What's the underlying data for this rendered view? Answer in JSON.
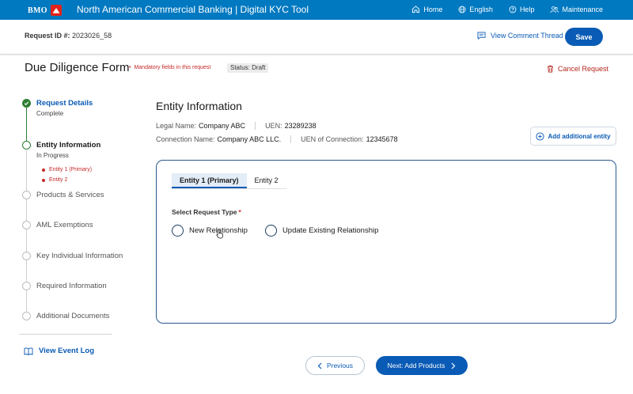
{
  "topbar": {
    "logo_text": "BMO",
    "title": "North American Commercial Banking | Digital KYC Tool",
    "nav": [
      {
        "label": "Home",
        "icon": "home-icon"
      },
      {
        "label": "English",
        "icon": "globe-icon"
      },
      {
        "label": "Help",
        "icon": "help-icon"
      },
      {
        "label": "Maintenance",
        "icon": "users-icon"
      }
    ]
  },
  "request": {
    "id_label": "Request ID #:",
    "id_value": "2023026_58",
    "comment_link": "View Comment Thread",
    "save_label": "Save"
  },
  "form": {
    "title": "Due Diligence Form",
    "mandatory_note": "Mandatory fields in this request",
    "status": "Status: Draft",
    "cancel_label": "Cancel Request"
  },
  "stepper": {
    "steps": [
      {
        "label": "Request Details",
        "sub": "Complete",
        "state": "done"
      },
      {
        "label": "Entity Information",
        "sub": "In Progress",
        "state": "active"
      },
      {
        "label": "Products & Services",
        "state": "pending"
      },
      {
        "label": "AML Exemptions",
        "state": "pending"
      },
      {
        "label": "Key Individual Information",
        "state": "pending"
      },
      {
        "label": "Required Information",
        "state": "pending"
      },
      {
        "label": "Additional Documents",
        "state": "pending"
      }
    ],
    "substeps": [
      "Entity 1 (Primary)",
      "Entity 2"
    ],
    "event_log": "View Event Log"
  },
  "entity": {
    "section_title": "Entity Information",
    "legal_name_label": "Legal Name:",
    "legal_name": "Company ABC",
    "uen_label": "UEN:",
    "uen": "23289238",
    "connection_name_label": "Connection Name:",
    "connection_name": "Company ABC LLC.",
    "uen_connection_label": "UEN of Connection:",
    "uen_connection": "12345678",
    "add_entity_label": "Add additional entity",
    "tabs": [
      "Entity 1 (Primary)",
      "Entity 2"
    ],
    "request_type_label": "Select Request Type",
    "request_type_required": "*",
    "request_type_options": [
      "New Relationship",
      "Update Existing Relationship"
    ]
  },
  "footer": {
    "prev_label": "Previous",
    "next_label": "Next: Add Products"
  },
  "colors": {
    "brand_blue": "#0079c1",
    "primary_button": "#0a5bb5",
    "complete_green": "#2e7d32",
    "error_red": "#c62828",
    "logo_red": "#e2231a"
  }
}
